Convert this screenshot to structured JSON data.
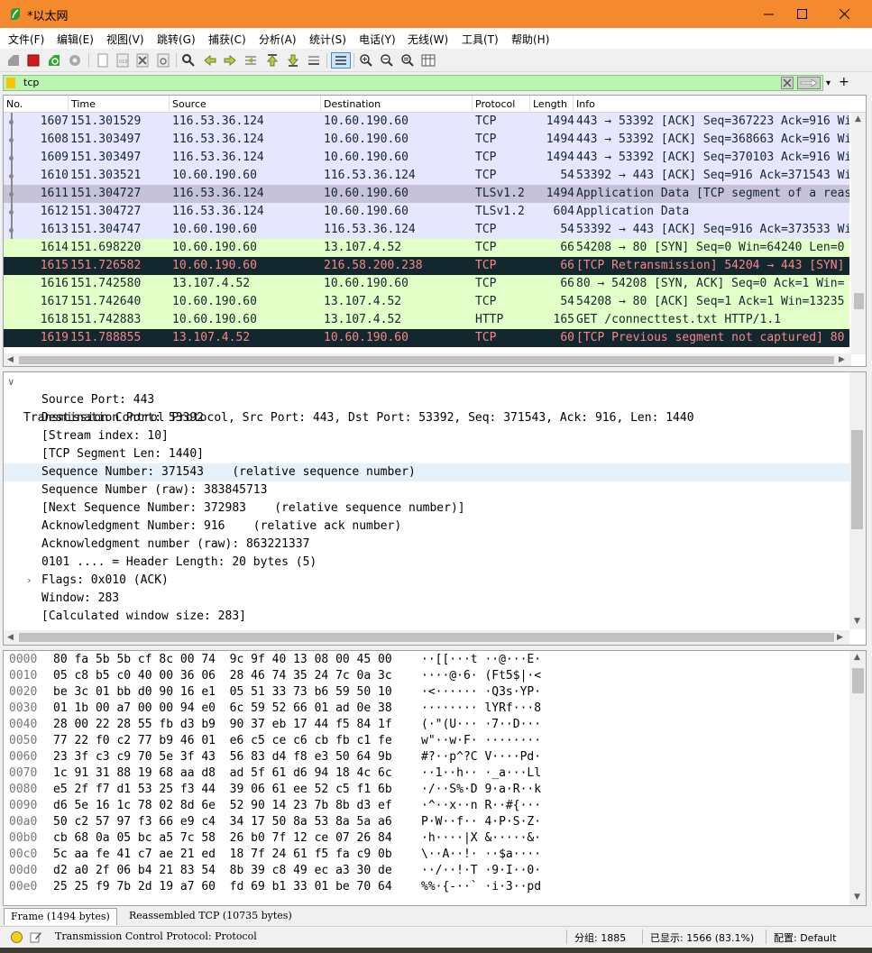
{
  "window": {
    "title": "*以太网",
    "title_color": "#f5892e"
  },
  "menu": [
    "文件(F)",
    "编辑(E)",
    "视图(V)",
    "跳转(G)",
    "捕获(C)",
    "分析(A)",
    "统计(S)",
    "电话(Y)",
    "无线(W)",
    "工具(T)",
    "帮助(H)"
  ],
  "toolbar": {
    "icons": [
      "start-capture-icon",
      "stop-capture-icon",
      "restart-capture-icon",
      "capture-options-icon",
      "open-file-icon",
      "save-file-icon",
      "close-file-icon",
      "reload-file-icon",
      "find-packet-icon",
      "go-back-icon",
      "go-forward-icon",
      "go-to-packet-icon",
      "go-first-icon",
      "go-last-icon",
      "auto-scroll-icon",
      "colorize-icon",
      "zoom-in-icon",
      "zoom-out-icon",
      "zoom-normal-icon",
      "resize-columns-icon"
    ]
  },
  "filter": {
    "value": "tcp",
    "bg": "#b9f5b0"
  },
  "packet_list": {
    "columns": [
      "No.",
      "Time",
      "Source",
      "Destination",
      "Protocol",
      "Length",
      "Info"
    ],
    "rows": [
      {
        "no": "1607",
        "time": "151.301529",
        "src": "116.53.36.124",
        "dst": "10.60.190.60",
        "proto": "TCP",
        "len": "1494",
        "info": "443 → 53392 [ACK] Seq=367223 Ack=916 Win=",
        "bg": "#e7e6ff",
        "fg": "#12272e"
      },
      {
        "no": "1608",
        "time": "151.303497",
        "src": "116.53.36.124",
        "dst": "10.60.190.60",
        "proto": "TCP",
        "len": "1494",
        "info": "443 → 53392 [ACK] Seq=368663 Ack=916 Win=",
        "bg": "#e7e6ff",
        "fg": "#12272e"
      },
      {
        "no": "1609",
        "time": "151.303497",
        "src": "116.53.36.124",
        "dst": "10.60.190.60",
        "proto": "TCP",
        "len": "1494",
        "info": "443 → 53392 [ACK] Seq=370103 Ack=916 Win=",
        "bg": "#e7e6ff",
        "fg": "#12272e"
      },
      {
        "no": "1610",
        "time": "151.303521",
        "src": "10.60.190.60",
        "dst": "116.53.36.124",
        "proto": "TCP",
        "len": "54",
        "info": "53392 → 443 [ACK] Seq=916 Ack=371543 Win=",
        "bg": "#e7e6ff",
        "fg": "#12272e"
      },
      {
        "no": "1611",
        "time": "151.304727",
        "src": "116.53.36.124",
        "dst": "10.60.190.60",
        "proto": "TLSv1.2",
        "len": "1494",
        "info": "Application Data [TCP segment of a reas",
        "bg": "#c6c3d8",
        "fg": "#12272e"
      },
      {
        "no": "1612",
        "time": "151.304727",
        "src": "116.53.36.124",
        "dst": "10.60.190.60",
        "proto": "TLSv1.2",
        "len": "604",
        "info": "Application Data",
        "bg": "#e7e6ff",
        "fg": "#12272e"
      },
      {
        "no": "1613",
        "time": "151.304747",
        "src": "10.60.190.60",
        "dst": "116.53.36.124",
        "proto": "TCP",
        "len": "54",
        "info": "53392 → 443 [ACK] Seq=916 Ack=373533 Win=",
        "bg": "#e7e6ff",
        "fg": "#12272e"
      },
      {
        "no": "1614",
        "time": "151.698220",
        "src": "10.60.190.60",
        "dst": "13.107.4.52",
        "proto": "TCP",
        "len": "66",
        "info": "54208 → 80 [SYN] Seq=0 Win=64240 Len=0",
        "bg": "#e4ffc7",
        "fg": "#12272e"
      },
      {
        "no": "1615",
        "time": "151.726582",
        "src": "10.60.190.60",
        "dst": "216.58.200.238",
        "proto": "TCP",
        "len": "66",
        "info": "[TCP Retransmission] 54204 → 443 [SYN]",
        "bg": "#12272e",
        "fg": "#f78787"
      },
      {
        "no": "1616",
        "time": "151.742580",
        "src": "13.107.4.52",
        "dst": "10.60.190.60",
        "proto": "TCP",
        "len": "66",
        "info": "80 → 54208 [SYN, ACK] Seq=0 Ack=1 Win=",
        "bg": "#e4ffc7",
        "fg": "#12272e"
      },
      {
        "no": "1617",
        "time": "151.742640",
        "src": "10.60.190.60",
        "dst": "13.107.4.52",
        "proto": "TCP",
        "len": "54",
        "info": "54208 → 80 [ACK] Seq=1 Ack=1 Win=13235",
        "bg": "#e4ffc7",
        "fg": "#12272e"
      },
      {
        "no": "1618",
        "time": "151.742883",
        "src": "10.60.190.60",
        "dst": "13.107.4.52",
        "proto": "HTTP",
        "len": "165",
        "info": "GET /connecttest.txt HTTP/1.1",
        "bg": "#e4ffc7",
        "fg": "#12272e"
      },
      {
        "no": "1619",
        "time": "151.788855",
        "src": "13.107.4.52",
        "dst": "10.60.190.60",
        "proto": "TCP",
        "len": "60",
        "info": "[TCP Previous segment not captured] 80",
        "bg": "#12272e",
        "fg": "#f78787"
      }
    ]
  },
  "details": {
    "header": "Transmission Control Protocol, Src Port: 443, Dst Port: 53392, Seq: 371543, Ack: 916, Len: 1440",
    "lines": [
      "Source Port: 443",
      "Destination Port: 53392",
      "[Stream index: 10]",
      "[TCP Segment Len: 1440]",
      "Sequence Number: 371543    (relative sequence number)",
      "Sequence Number (raw): 383845713",
      "[Next Sequence Number: 372983    (relative sequence number)]",
      "Acknowledgment Number: 916    (relative ack number)",
      "Acknowledgment number (raw): 863221337",
      "0101 .... = Header Length: 20 bytes (5)",
      "Flags: 0x010 (ACK)",
      "Window: 283",
      "[Calculated window size: 283]"
    ],
    "selected_index": 4,
    "expandable_index": 10,
    "select_color": "#e5f2fb"
  },
  "bytes": {
    "rows": [
      {
        "off": "0000",
        "hex": "80 fa 5b 5b cf 8c 00 74  9c 9f 40 13 08 00 45 00",
        "ascii": "··[[···t ··@···E·"
      },
      {
        "off": "0010",
        "hex": "05 c8 b5 c0 40 00 36 06  28 46 74 35 24 7c 0a 3c",
        "ascii": "····@·6· (Ft5$|·<"
      },
      {
        "off": "0020",
        "hex": "be 3c 01 bb d0 90 16 e1  05 51 33 73 b6 59 50 10",
        "ascii": "·<······ ·Q3s·YP·"
      },
      {
        "off": "0030",
        "hex": "01 1b 00 a7 00 00 94 e0  6c 59 52 66 01 ad 0e 38",
        "ascii": "········ lYRf···8"
      },
      {
        "off": "0040",
        "hex": "28 00 22 28 55 fb d3 b9  90 37 eb 17 44 f5 84 1f",
        "ascii": "(·\"(U··· ·7··D···"
      },
      {
        "off": "0050",
        "hex": "77 22 f0 c2 77 b9 46 01  e6 c5 ce c6 cb fb c1 fe",
        "ascii": "w\"··w·F· ········"
      },
      {
        "off": "0060",
        "hex": "23 3f c3 c9 70 5e 3f 43  56 83 d4 f8 e3 50 64 9b",
        "ascii": "#?··p^?C V····Pd·"
      },
      {
        "off": "0070",
        "hex": "1c 91 31 88 19 68 aa d8  ad 5f 61 d6 94 18 4c 6c",
        "ascii": "··1··h·· ·_a···Ll"
      },
      {
        "off": "0080",
        "hex": "e5 2f f7 d1 53 25 f3 44  39 06 61 ee 52 c5 f1 6b",
        "ascii": "·/··S%·D 9·a·R··k"
      },
      {
        "off": "0090",
        "hex": "d6 5e 16 1c 78 02 8d 6e  52 90 14 23 7b 8b d3 ef",
        "ascii": "·^··x··n R··#{···"
      },
      {
        "off": "00a0",
        "hex": "50 c2 57 97 f3 66 e9 c4  34 17 50 8a 53 8a 5a a6",
        "ascii": "P·W··f·· 4·P·S·Z·"
      },
      {
        "off": "00b0",
        "hex": "cb 68 0a 05 bc a5 7c 58  26 b0 7f 12 ce 07 26 84",
        "ascii": "·h····|X &·····&·"
      },
      {
        "off": "00c0",
        "hex": "5c aa fe 41 c7 ae 21 ed  18 7f 24 61 f5 fa c9 0b",
        "ascii": "\\··A··!· ··$a····"
      },
      {
        "off": "00d0",
        "hex": "d2 a0 2f 06 b4 21 83 54  8b 39 c8 49 ec a3 30 de",
        "ascii": "··/··!·T ·9·I··0·"
      },
      {
        "off": "00e0",
        "hex": "25 25 f9 7b 2d 19 a7 60  fd 69 b1 33 01 be 70 64",
        "ascii": "%%·{-··` ·i·3··pd"
      }
    ]
  },
  "bytes_tabs": [
    "Frame (1494 bytes)",
    "Reassembled TCP (10735 bytes)"
  ],
  "status": {
    "text": "Transmission Control Protocol: Protocol",
    "packets": "分组: 1885",
    "displayed": "已显示: 1566 (83.1%)",
    "profile": "配置: Default"
  }
}
